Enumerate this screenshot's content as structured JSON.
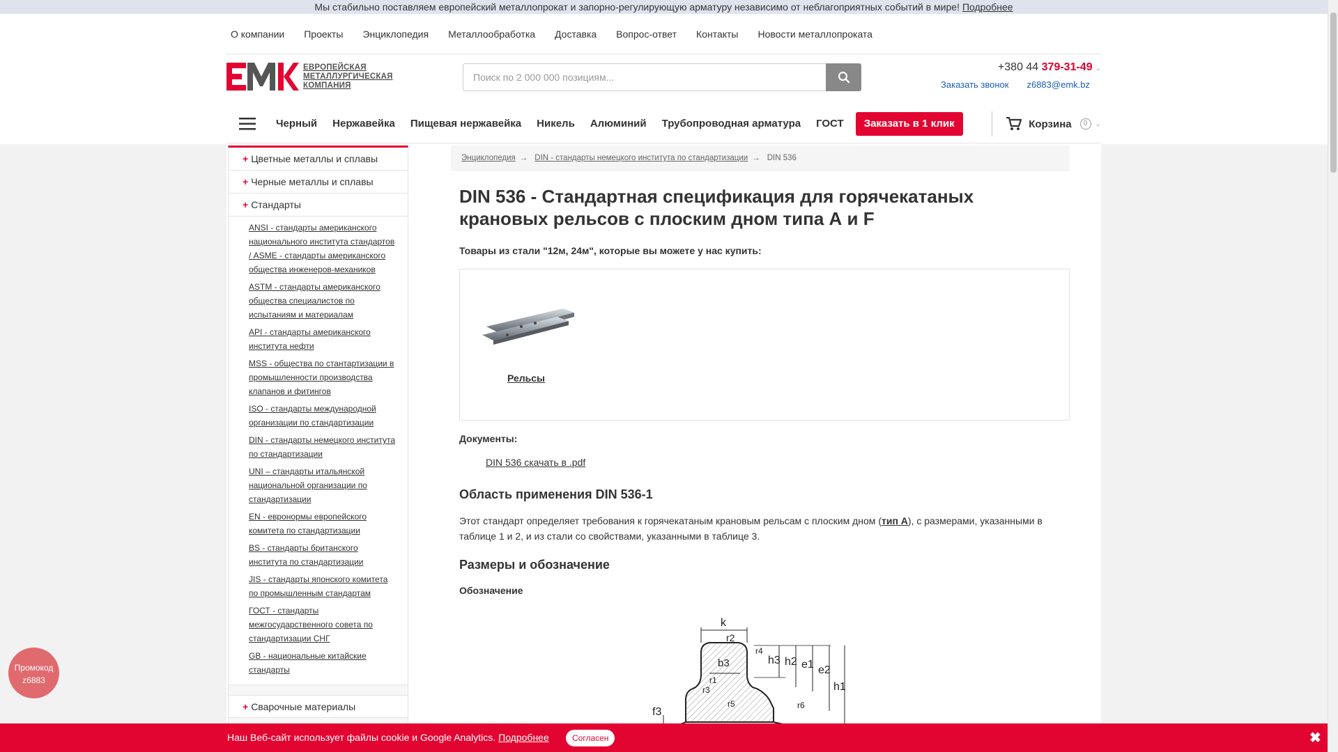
{
  "topbar": {
    "text": "Мы стабильно поставляем европейский металлопрокат и запорно-регулирующую арматуру независимо от неблагоприятных событий в мире!",
    "link": "Подробнее"
  },
  "topnav": [
    "О компании",
    "Проекты",
    "Энциклопедия",
    "Металлообработка",
    "Доставка",
    "Вопрос-ответ",
    "Контакты",
    "Новости металлопроката"
  ],
  "logo": {
    "mark": "EMK",
    "line1": "Европейская",
    "line2": "металлургическая",
    "line3": "компания"
  },
  "search": {
    "placeholder": "Поиск по 2 000 000 позициям..."
  },
  "contacts": {
    "phone_prefix": "+380 44 ",
    "phone_number": "379-31-49",
    "callback": "Заказать звонок",
    "email": "z6883@emk.bz"
  },
  "catbar": {
    "categories": [
      "Черный",
      "Нержавейка",
      "Пищевая нержавейка",
      "Никель",
      "Алюминий",
      "Трубопроводная арматура",
      "ГОСТ"
    ],
    "order_button": "Заказать в 1 клик",
    "cart_label": "Корзина",
    "cart_count": "0"
  },
  "sidebar": {
    "sections": [
      "Цветные металлы и сплавы",
      "Черные металлы и сплавы",
      "Стандарты"
    ],
    "standards": [
      "ANSI - стандарты американского национального института стандартов / ASME - стандарты американского общества инженеров-механиков",
      "ASTM - стандарты американского общества специалистов по испытаниям и материалам",
      "API - стандарты американского института нефти",
      "MSS - общества по стантартизации в промышленности производства клапанов и фитингов",
      "ISO - стандарты международной организации по стандартизации",
      "DIN - стандарты немецкого института по стандартизации",
      "UNI – стандарты итальянской национальной организации по стандартизации",
      "EN - евронормы европейского комитета по стандартизации",
      "BS - стандарты британского института по стандартизации",
      "JIS - стандарты японского комитета по промышленным стандартам",
      "ГОСТ - стандарты межгосударственного совета по стандартизации СНГ",
      "GB - национальные китайские стандарты"
    ],
    "bottom_section": "Сварочные материалы"
  },
  "breadcrumb": {
    "items": [
      "Энциклопедия",
      "DIN - стандарты немецкого института по стандартизации"
    ],
    "current": "DIN 536",
    "separator": "→"
  },
  "main": {
    "title": "DIN 536 - Стандартная спецификация для горячекатаных крановых рельсов с плоским дном типа А и F",
    "subtitle": "Товары из стали \"12м, 24м\", которые вы можете у нас купить:",
    "product_label": "Рельсы",
    "documents_title": "Документы:",
    "document_link": "DIN 536 скачать в .pdf",
    "section1_title": "Область применения DIN 536-1",
    "section1_text_before": "Этот стандарт определяет требования к горячекатаным крановым рельсам с плоским дном (",
    "section1_text_bold": "тип А",
    "section1_text_after": "), с размерами, указанными в таблице 1 и 2, и из стали со свойствами, указанными в таблице 3.",
    "section2_title": "Размеры и обозначение",
    "section2_sub": "Обозначение",
    "diagram_labels": [
      "k",
      "r2",
      "b3",
      "h3",
      "h2",
      "e1",
      "e2",
      "h1",
      "f3",
      "r3",
      "r5",
      "r4",
      "r6",
      "r1"
    ]
  },
  "promo": {
    "line1": "Промокод",
    "line2": "z6883"
  },
  "cookie": {
    "text": "Наш Веб-сайт использует файлы cookie и Google Analytics.",
    "link": "Подробнее",
    "button": "Согласен",
    "close": "✖"
  },
  "colors": {
    "accent": "#e30531",
    "link": "#1a5fb4",
    "topbar": "#dee3ee"
  }
}
